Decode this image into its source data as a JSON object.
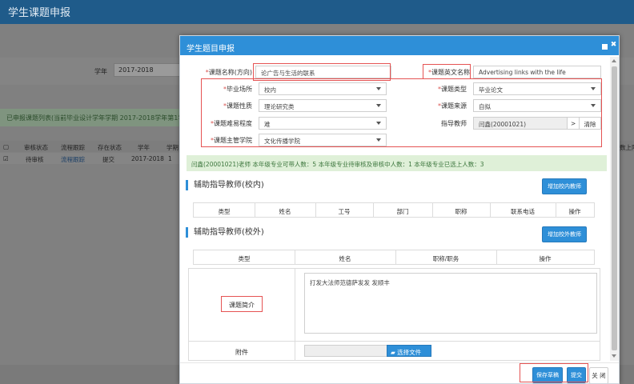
{
  "background": {
    "header_title": "学生课题申报",
    "year_label": "学年",
    "year_value": "2017-2018",
    "banner_text": "已申报课题列表(当前毕业设计学年学期 2017-2018学年第1学期",
    "table_headers": [
      "审核状态",
      "流程跟踪",
      "存在状态",
      "学年",
      "学期"
    ],
    "table_row": [
      "待审核",
      "流程跟踪",
      "提交",
      "2017-2018",
      "1"
    ],
    "right_header": "数上限"
  },
  "modal": {
    "title": "学生题目申报",
    "fields": {
      "topic_name_label": "课题名称(方向)",
      "topic_name_value": "论广告与生活的联系",
      "topic_en_label": "课题英文名称",
      "topic_en_value": "Advertising links with the life",
      "site_label": "毕业场所",
      "site_value": "校内",
      "type_label": "课题类型",
      "type_value": "毕业论文",
      "nature_label": "课题性质",
      "nature_value": "理论研究类",
      "source_label": "课题来源",
      "source_value": "自拟",
      "difficulty_label": "课题难易程度",
      "difficulty_value": "难",
      "advisor_label": "指导教师",
      "advisor_value": "闫鑫(20001021)",
      "advisor_select": ">",
      "advisor_clear": "清除",
      "college_label": "课题主管学院",
      "college_value": "文化传播学院"
    },
    "info_bar": "闫鑫(20001021)老师 本年级专业可带人数：5  本年级专业待审核及审核中人数：1  本年级专业已选上人数：3",
    "internal_section": {
      "title": "辅助指导教师(校内)",
      "add_button": "增加校内教师",
      "columns": [
        "类型",
        "姓名",
        "工号",
        "部门",
        "职称",
        "联系电话",
        "操作"
      ]
    },
    "external_section": {
      "title": "辅助指导教师(校外)",
      "add_button": "增加校外教师",
      "columns": [
        "类型",
        "姓名",
        "职称/职务",
        "操作"
      ]
    },
    "intro_label": "课题简介",
    "intro_value": "打发大法师范德萨发发 发顺丰",
    "attachment_label": "附件",
    "file_button": "选择文件",
    "save_draft": "保存草稿",
    "submit": "提交",
    "close": "关 闭"
  }
}
